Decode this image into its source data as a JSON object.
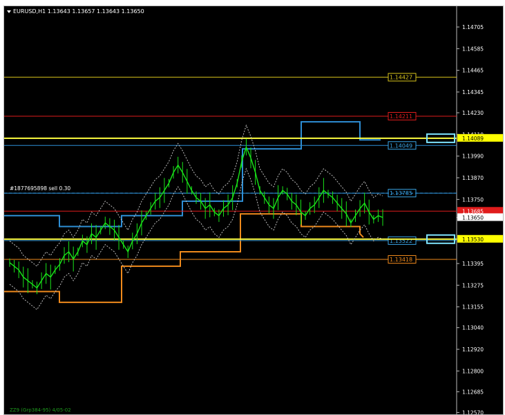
{
  "window": {
    "symbol_line": "EURUSD,H1  1.13643 1.13657 1.13643 1.13650",
    "order_label": "#1877695898 sell 0.30",
    "footer_label": "ZZ9 (Grp384-95) 4/05-02"
  },
  "chart_data": {
    "type": "line",
    "title": "EURUSD,H1",
    "ylim": [
      1.1256,
      1.1482
    ],
    "y_ticks": [
      "1.14705",
      "1.14585",
      "1.14465",
      "1.14345",
      "1.14230",
      "1.14110",
      "1.13990",
      "1.13870",
      "1.13750",
      "1.13650",
      "1.13530",
      "1.13395",
      "1.13275",
      "1.13155",
      "1.13040",
      "1.12920",
      "1.12800",
      "1.12685",
      "1.12570"
    ],
    "y_tick_values": [
      1.14705,
      1.14585,
      1.14465,
      1.14345,
      1.1423,
      1.1411,
      1.1399,
      1.1387,
      1.1375,
      1.1365,
      1.1353,
      1.13395,
      1.13275,
      1.13155,
      1.1304,
      1.1292,
      1.128,
      1.12685,
      1.1257
    ],
    "levels": [
      {
        "label": "1.14427",
        "value": 1.14427,
        "color": "#d9c51c",
        "text_color": "#d9c51c"
      },
      {
        "label": "1.14211",
        "value": 1.14211,
        "color": "#e01c1c",
        "text_color": "#e01c1c"
      },
      {
        "label": "1.14049",
        "value": 1.14049,
        "color": "#2e8fd6",
        "text_color": "#3aa6e8"
      },
      {
        "label": "1.13785",
        "value": 1.13785,
        "color": "#2e8fd6",
        "text_color": "#3aa6e8"
      },
      {
        "label": "1.13522",
        "value": 1.13522,
        "color": "#2e8fd6",
        "text_color": "#3aa6e8"
      },
      {
        "label": "1.13418",
        "value": 1.13418,
        "color": "#f08a1c",
        "text_color": "#f08a1c"
      }
    ],
    "axis_flags": [
      {
        "label": "1.14089",
        "value": 1.14089,
        "bg": "#ffff00",
        "fg": "#000000"
      },
      {
        "label": "1.13685",
        "value": 1.13685,
        "bg": "#e01c1c",
        "fg": "#ffffff"
      },
      {
        "label": "1.13650",
        "value": 1.1365,
        "bg": "#ffffff",
        "fg": "#000000"
      },
      {
        "label": "1.13530",
        "value": 1.1353,
        "bg": "#ffff00",
        "fg": "#000000"
      }
    ],
    "price_series": [
      1.134,
      1.1338,
      1.1336,
      1.1332,
      1.133,
      1.1328,
      1.1326,
      1.133,
      1.1334,
      1.1332,
      1.1336,
      1.1339,
      1.1344,
      1.1346,
      1.1342,
      1.1346,
      1.1352,
      1.135,
      1.1356,
      1.1354,
      1.1358,
      1.1362,
      1.136,
      1.1358,
      1.1354,
      1.135,
      1.1346,
      1.1352,
      1.1356,
      1.1362,
      1.1366,
      1.137,
      1.1374,
      1.1376,
      1.138,
      1.1384,
      1.139,
      1.1394,
      1.139,
      1.1385,
      1.138,
      1.1376,
      1.1374,
      1.137,
      1.1372,
      1.1368,
      1.1366,
      1.137,
      1.1372,
      1.1376,
      1.1384,
      1.1396,
      1.1404,
      1.1398,
      1.139,
      1.138,
      1.1376,
      1.1372,
      1.137,
      1.1376,
      1.138,
      1.1378,
      1.1374,
      1.1372,
      1.1368,
      1.1366,
      1.137,
      1.1372,
      1.1376,
      1.138,
      1.1378,
      1.1376,
      1.1373,
      1.137,
      1.1367,
      1.1362,
      1.1366,
      1.137,
      1.1373,
      1.1368,
      1.1364,
      1.1366,
      1.1365
    ],
    "colors": {
      "background": "#000000",
      "price": "#19e619",
      "axis_text": "#ffffff",
      "current_line": "#cccccc"
    }
  }
}
